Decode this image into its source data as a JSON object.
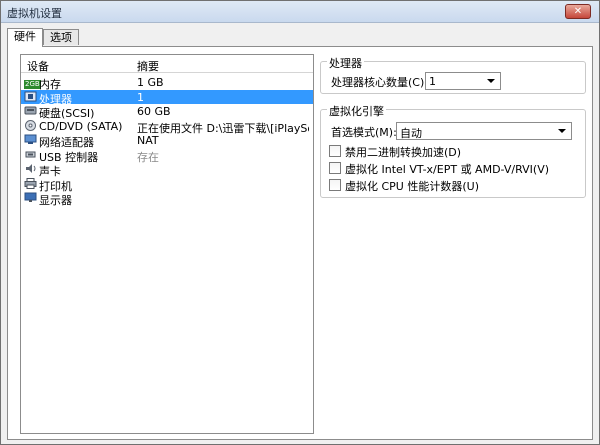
{
  "window": {
    "title": "虚拟机设置",
    "close_icon": "close-icon"
  },
  "tabs": [
    {
      "label": "硬件",
      "active": true
    },
    {
      "label": "选项",
      "active": false
    }
  ],
  "device_list": {
    "col_device": "设备",
    "col_summary": "摘要",
    "rows": [
      {
        "name": "内存",
        "summary": "1 GB",
        "icon": "memory-icon",
        "icon_text": "2GB"
      },
      {
        "name": "处理器",
        "summary": "1",
        "icon": "processor-icon",
        "selected": true
      },
      {
        "name": "硬盘(SCSI)",
        "summary": "60 GB",
        "icon": "hard-disk-icon"
      },
      {
        "name": "CD/DVD (SATA)",
        "summary": "正在使用文件 D:\\迅雷下载\\[iPlaySof...",
        "icon": "cd-dvd-icon"
      },
      {
        "name": "网络适配器",
        "summary": "NAT",
        "icon": "network-adapter-icon"
      },
      {
        "name": "USB 控制器",
        "summary": "存在",
        "icon": "usb-icon",
        "dim": true
      },
      {
        "name": "声卡",
        "summary": "",
        "icon": "sound-card-icon"
      },
      {
        "name": "打印机",
        "summary": "",
        "icon": "printer-icon"
      },
      {
        "name": "显示器",
        "summary": "",
        "icon": "display-icon"
      }
    ]
  },
  "processor_group": {
    "title": "处理器",
    "cores_label": "处理器核心数量(C):",
    "cores_value": "1"
  },
  "virtualization_group": {
    "title": "虚拟化引擎",
    "mode_label": "首选模式(M):",
    "mode_value": "自动",
    "checkboxes": [
      {
        "label": "禁用二进制转换加速(D)",
        "checked": false
      },
      {
        "label": "虚拟化 Intel VT-x/EPT 或 AMD-V/RVI(V)",
        "checked": false
      },
      {
        "label": "虚拟化 CPU 性能计数器(U)",
        "checked": false
      }
    ]
  },
  "colors": {
    "selection": "#3399ff",
    "window_bg": "#f0f0f0"
  }
}
